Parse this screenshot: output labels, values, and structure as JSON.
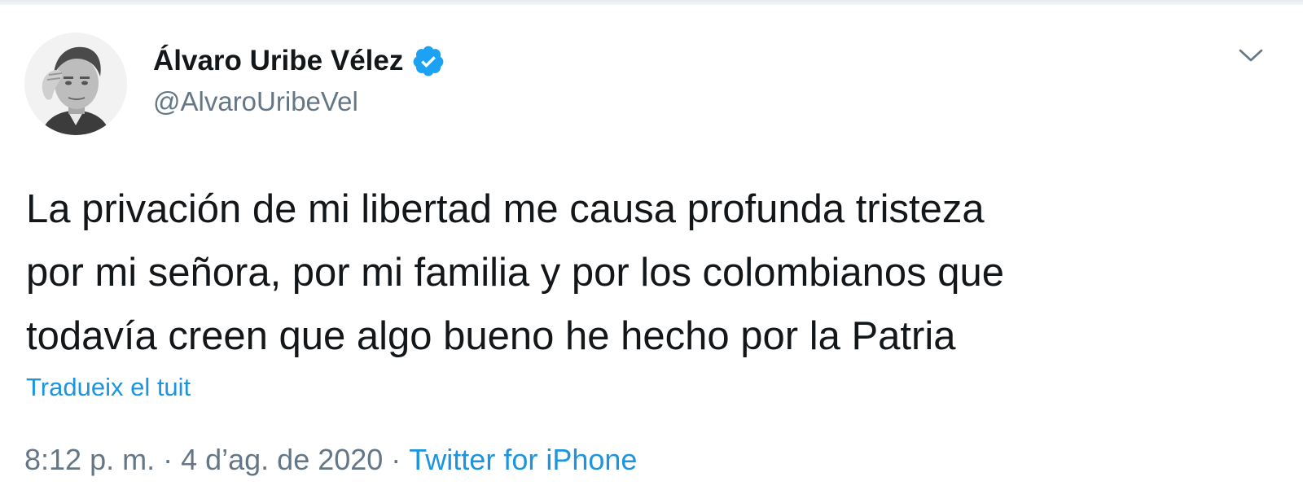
{
  "tweet": {
    "author": {
      "display_name": "Álvaro Uribe Vélez",
      "handle": "@AlvaroUribeVel",
      "verified": true
    },
    "text_lines": [
      "La privación de mi libertad me causa profunda tristeza",
      "por mi señora, por mi familia y por los colombianos que",
      "todavía creen que algo bueno he hecho por la Patria"
    ],
    "translate_label": "Tradueix el tuit",
    "timestamp": "8:12 p. m. · 4 d’ag. de 2020",
    "separator": "·",
    "source": "Twitter for iPhone"
  },
  "icons": {
    "verified": "verified-badge-icon",
    "menu": "chevron-down-icon"
  },
  "colors": {
    "text": "#14171a",
    "secondary": "#657786",
    "link": "#1b95e0",
    "verified_badge": "#1da1f2"
  }
}
